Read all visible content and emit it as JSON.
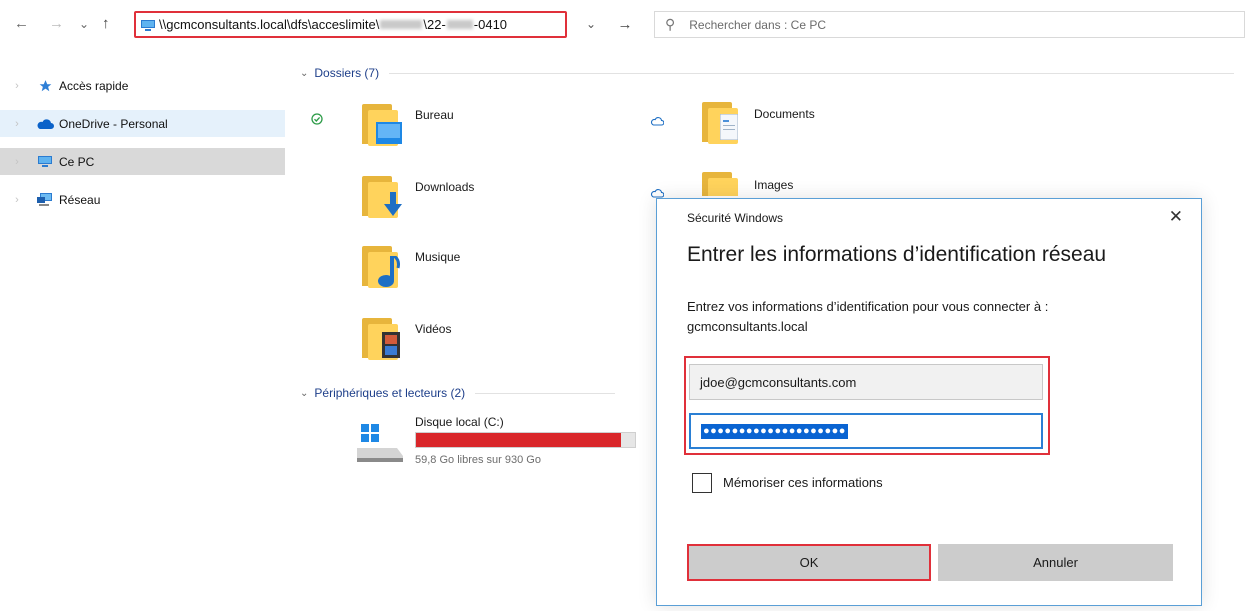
{
  "nav": {
    "back": "←",
    "forward": "→",
    "recent": "⌄",
    "up": "↑"
  },
  "address": {
    "prefix": "\\\\gcmconsultants.local\\dfs\\acceslimite\\",
    "middle": "\\22-",
    "suffix": "-0410",
    "dropdown": "⌄",
    "go": "→"
  },
  "search": {
    "placeholder": "Rechercher dans : Ce PC"
  },
  "sidebar": {
    "items": [
      {
        "label": "Accès rapide",
        "icon": "star-icon"
      },
      {
        "label": "OneDrive - Personal",
        "icon": "cloud-icon"
      },
      {
        "label": "Ce PC",
        "icon": "pc-icon"
      },
      {
        "label": "Réseau",
        "icon": "network-icon"
      }
    ]
  },
  "main": {
    "folders_header": "Dossiers (7)",
    "folders": [
      {
        "label": "Bureau",
        "status": "synced-check-icon"
      },
      {
        "label": "Documents",
        "status": "cloud-outline-icon"
      },
      {
        "label": "Downloads"
      },
      {
        "label": "Images",
        "status": "cloud-outline-icon"
      },
      {
        "label": "Musique"
      },
      {
        "label": "Vidéos"
      }
    ],
    "devices_header": "Périphériques et lecteurs (2)",
    "drive": {
      "label": "Disque local (C:)",
      "free_text": "59,8 Go libres sur 930 Go",
      "used_fraction": 0.936,
      "bar_color": "#d9262a"
    }
  },
  "dialog": {
    "title": "Sécurité Windows",
    "close": "✕",
    "heading": "Entrer les informations d’identification réseau",
    "desc_line1": "Entrez vos informations d’identification pour vous connecter à :",
    "desc_line2": "gcmconsultants.local",
    "username": "jdoe@gcmconsultants.com",
    "password_mask": "●●●●●●●●●●●●●●●●●●●●",
    "remember_label": "Mémoriser ces informations",
    "ok_label": "OK",
    "cancel_label": "Annuler"
  },
  "colors": {
    "highlight_red": "#e0303a",
    "accent_blue": "#2a7fd4"
  }
}
